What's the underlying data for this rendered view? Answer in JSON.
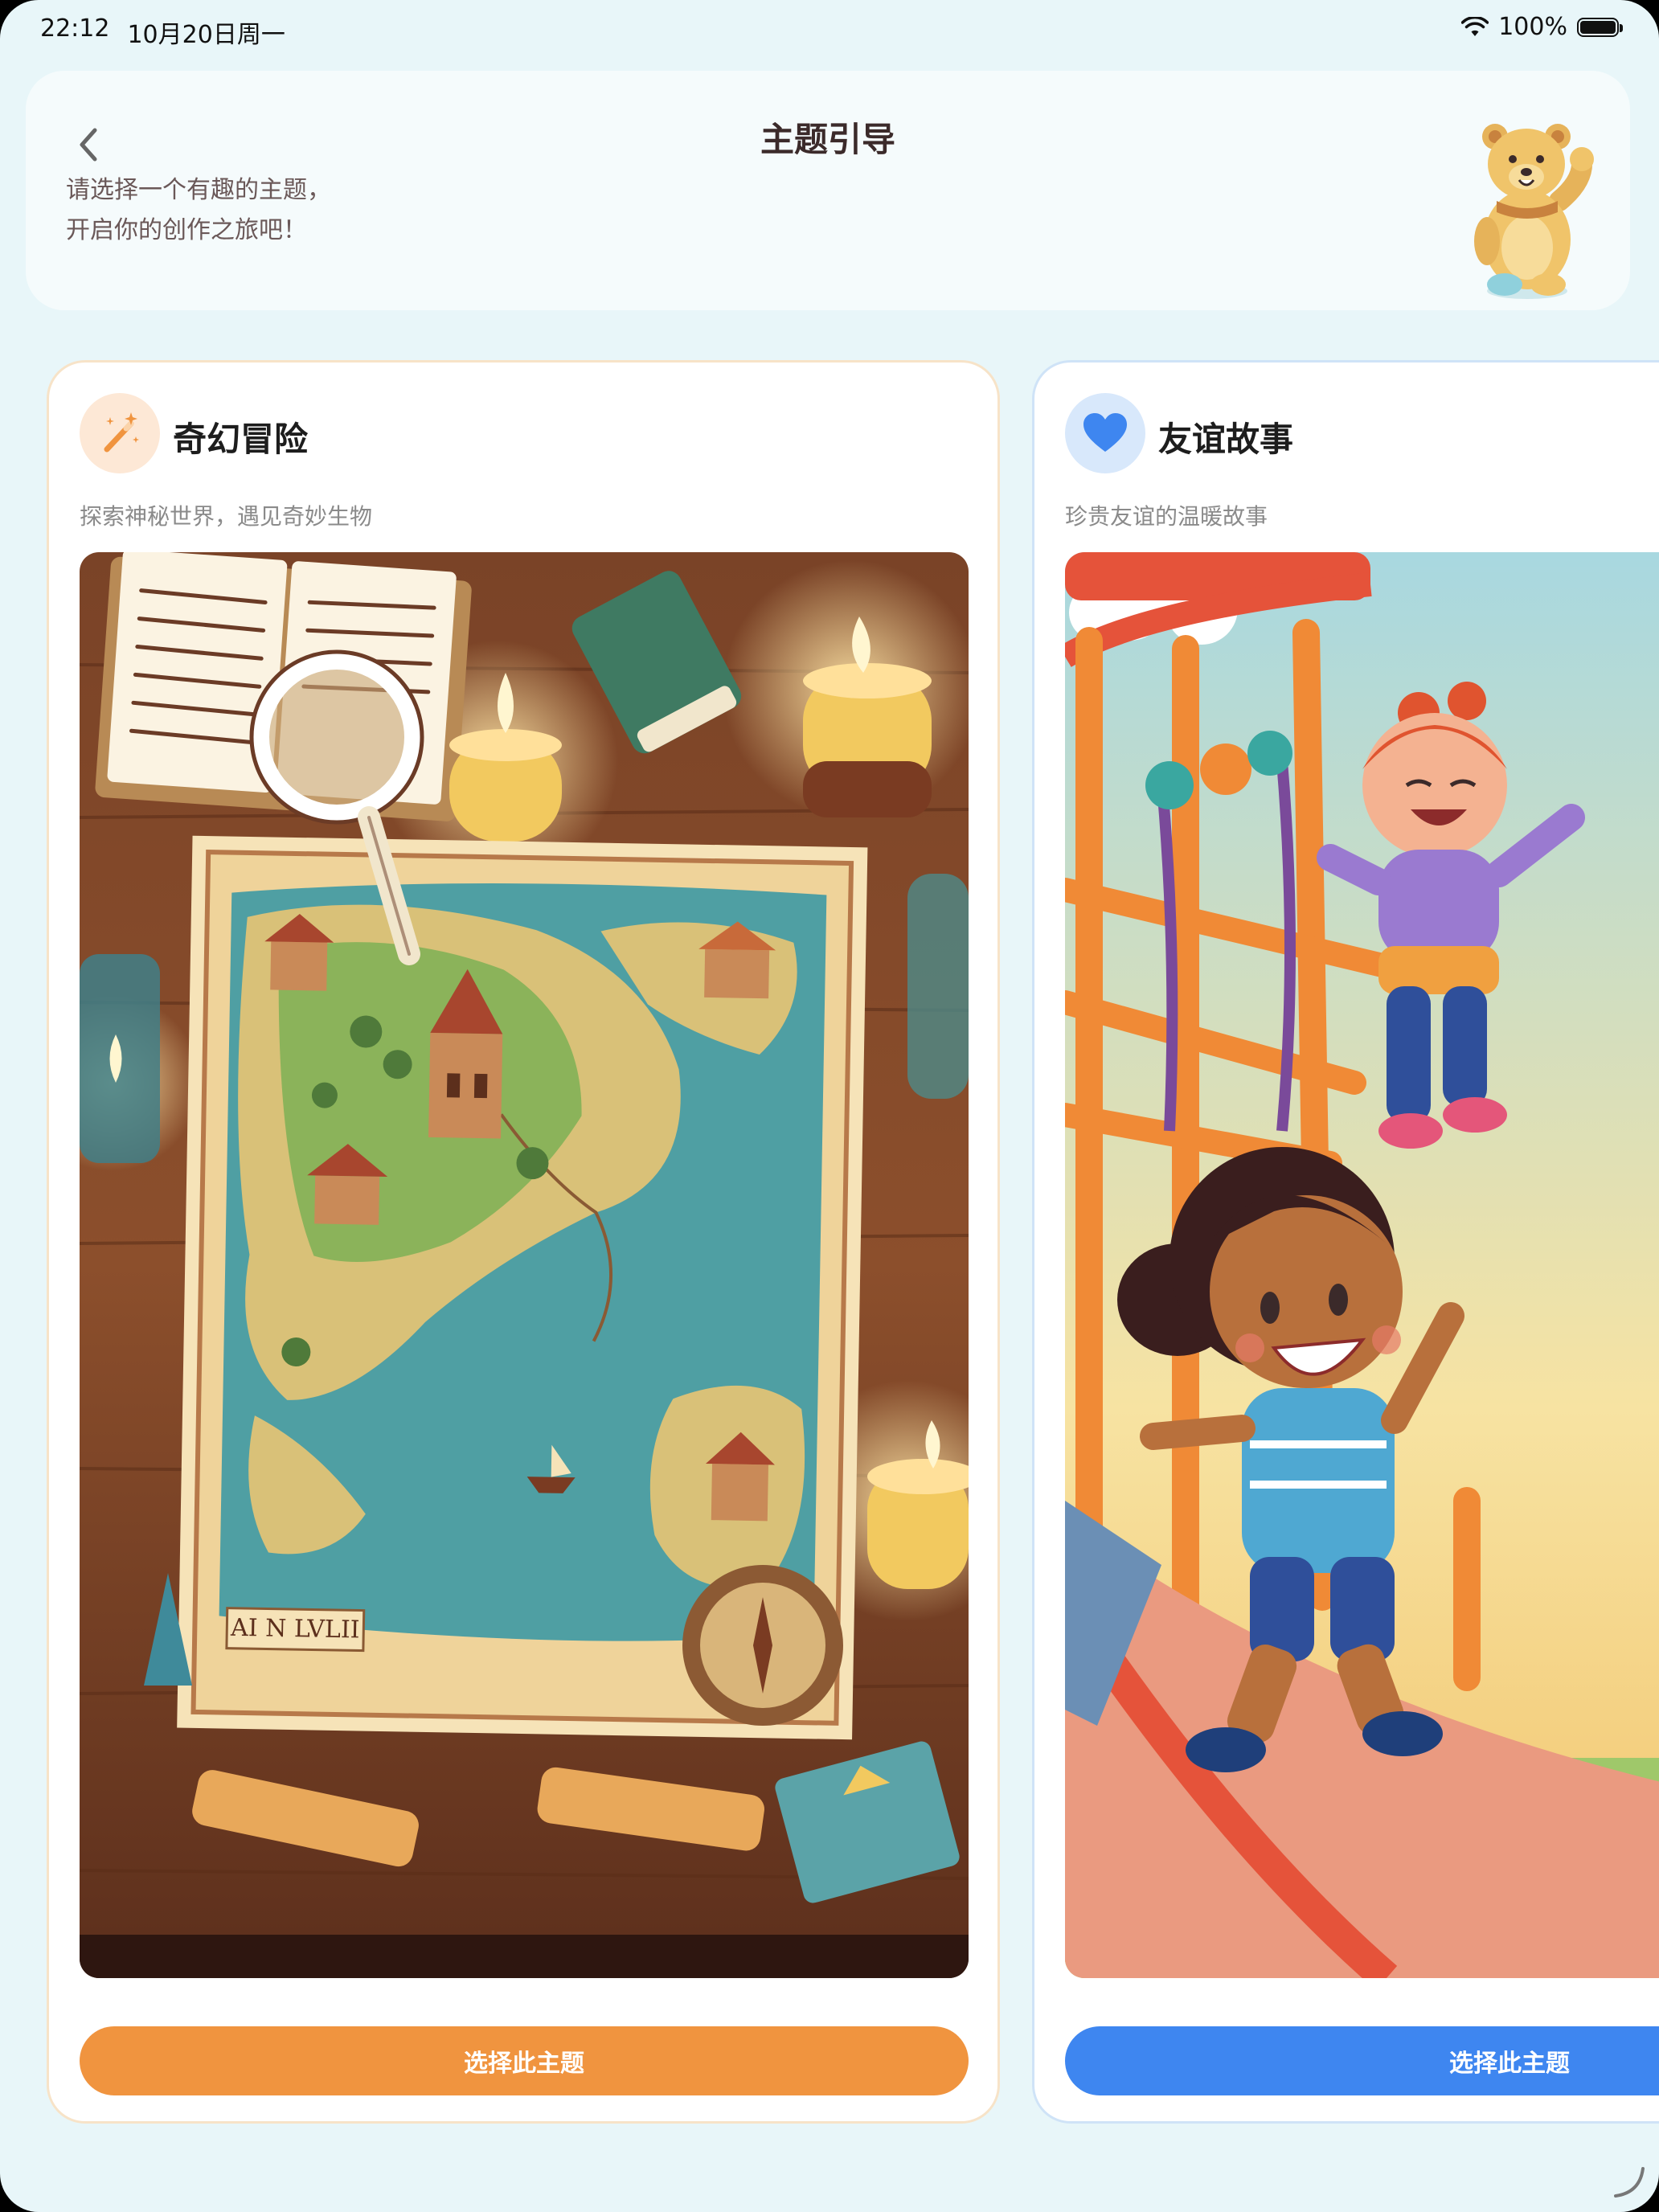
{
  "status_bar": {
    "time": "22:12",
    "date": "10月20日周一",
    "battery": "100%"
  },
  "header": {
    "title": "主题引导",
    "subtitle_line1": "请选择一个有趣的主题，",
    "subtitle_line2": "开启你的创作之旅吧！"
  },
  "themes": [
    {
      "title": "奇幻冒险",
      "description": "探索神秘世界，遇见奇妙生物",
      "button_label": "选择此主题",
      "icon": "magic-wand-icon",
      "accent_color": "#f0943f",
      "map_banner": "AI N LVLII"
    },
    {
      "title": "友谊故事",
      "description": "珍贵友谊的温暖故事",
      "button_label": "选择此主题",
      "icon": "heart-icon",
      "accent_color": "#3e86f0"
    }
  ],
  "colors": {
    "background": "#e8f6f9",
    "header_card": "#f5fbfc"
  }
}
